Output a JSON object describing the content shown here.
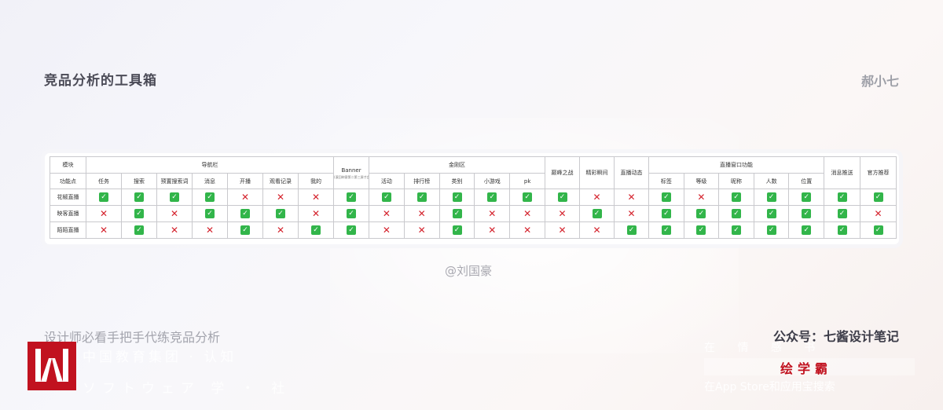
{
  "header": {
    "title": "竞品分析的工具箱",
    "author": "郝小七"
  },
  "table": {
    "row1": {
      "module_label": "模块",
      "groups": [
        "导航栏",
        "Banner",
        "金刚区",
        "巅峰之战",
        "精彩瞬间",
        "直播动态",
        "直播窗口功能",
        "消息推送",
        "官方推荐"
      ],
      "banner_note": "(滚回映客第二第三屏才会出现)"
    },
    "row2": {
      "feature_label": "功能点",
      "nav_items": [
        "任务",
        "搜索",
        "预置搜索词",
        "消息",
        "开播",
        "观看记录",
        "我的"
      ],
      "kingkong_items": [
        "活动",
        "排行榜",
        "类别",
        "小游戏",
        "pk"
      ],
      "live_items": [
        "标签",
        "等级",
        "昵称",
        "人数",
        "位置"
      ]
    },
    "rows": [
      {
        "name": "花椒直播",
        "marks": [
          1,
          1,
          1,
          1,
          0,
          0,
          0,
          1,
          1,
          1,
          1,
          1,
          1,
          1,
          0,
          0,
          1,
          0,
          1,
          1,
          1,
          1,
          1
        ]
      },
      {
        "name": "映客直播",
        "marks": [
          0,
          1,
          0,
          1,
          1,
          1,
          0,
          1,
          0,
          0,
          1,
          0,
          0,
          0,
          1,
          0,
          1,
          1,
          1,
          1,
          1,
          1,
          0
        ]
      },
      {
        "name": "陌陌直播",
        "marks": [
          0,
          1,
          0,
          0,
          1,
          0,
          1,
          1,
          0,
          0,
          1,
          0,
          0,
          0,
          0,
          1,
          1,
          1,
          1,
          1,
          1,
          1,
          1
        ]
      }
    ],
    "symbols": {
      "yes": "✓",
      "no": "✕"
    }
  },
  "watermark": "@刘国豪",
  "footer": {
    "subtitle": "设计师必看手把手代练竞品分析",
    "account": "公众号：七酱设计笔记",
    "brand": "绘学霸",
    "ghost_text_1": "中国教育集团 · 认知",
    "ghost_text_2": "ソフトウェア 学 ・ 社",
    "ghost_text_3": "在 情 感 书",
    "ghost_text_4": "在App Store和应用宝搜索"
  },
  "colors": {
    "yes": "#32b54a",
    "no": "#d4222c",
    "logo": "#c1121f"
  }
}
